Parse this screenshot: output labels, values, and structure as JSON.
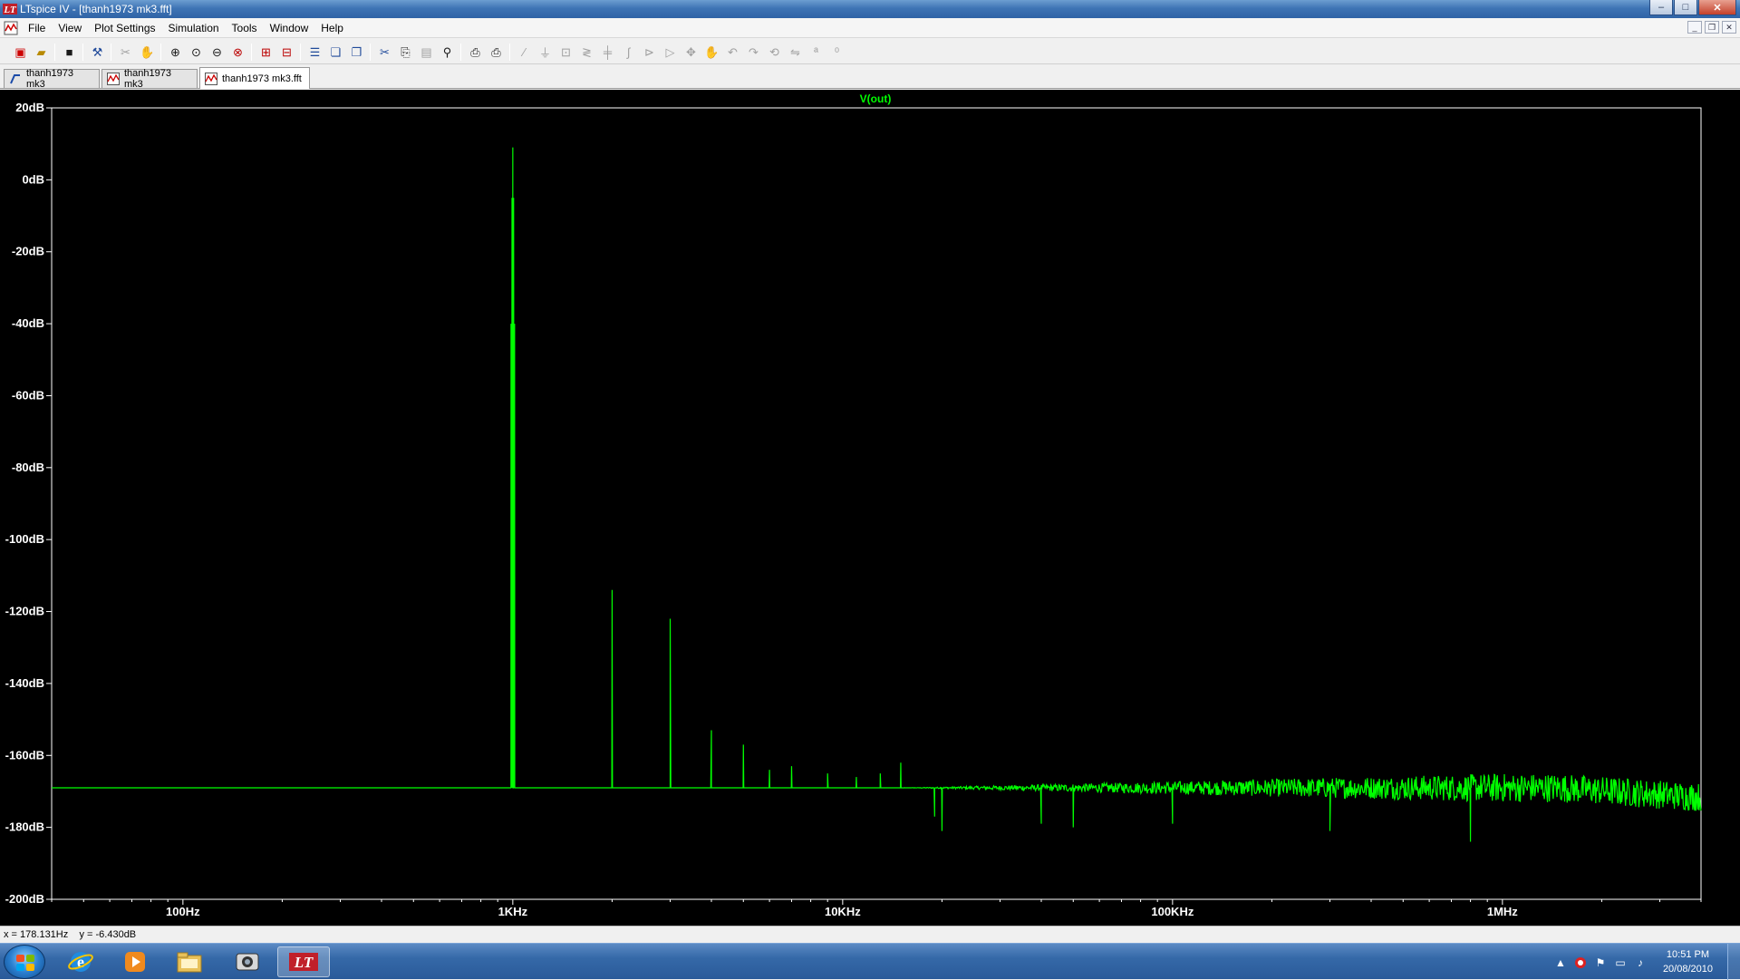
{
  "window": {
    "title": "LTspice IV - [thanh1973 mk3.fft]",
    "controls": {
      "minimize": "–",
      "maximize": "□",
      "close": "✕"
    }
  },
  "menu": {
    "items": [
      "File",
      "View",
      "Plot Settings",
      "Simulation",
      "Tools",
      "Window",
      "Help"
    ]
  },
  "mdi_controls": {
    "minimize": "_",
    "restore": "❐",
    "close": "✕"
  },
  "tabs": [
    {
      "label": "thanh1973 mk3",
      "icon": "schematic-icon"
    },
    {
      "label": "thanh1973 mk3",
      "icon": "waveform-icon"
    },
    {
      "label": "thanh1973 mk3.fft",
      "icon": "fft-icon",
      "active": true
    }
  ],
  "colors": {
    "trace": "#00ff00",
    "plot_bg": "#000000",
    "axis": "#ffffff",
    "trace_title": "#00ff00"
  },
  "chart_data": {
    "type": "line",
    "title": "V(out)",
    "xlabel": "",
    "ylabel": "",
    "x_scale": "log",
    "xlim": [
      40,
      4000000
    ],
    "ylim": [
      -200,
      20
    ],
    "x_ticks": [
      {
        "value": 100,
        "label": "100Hz"
      },
      {
        "value": 1000,
        "label": "1KHz"
      },
      {
        "value": 10000,
        "label": "10KHz"
      },
      {
        "value": 100000,
        "label": "100KHz"
      },
      {
        "value": 1000000,
        "label": "1MHz"
      }
    ],
    "y_ticks": [
      {
        "value": 20,
        "label": "20dB"
      },
      {
        "value": 0,
        "label": "0dB"
      },
      {
        "value": -20,
        "label": "-20dB"
      },
      {
        "value": -40,
        "label": "-40dB"
      },
      {
        "value": -60,
        "label": "-60dB"
      },
      {
        "value": -80,
        "label": "-80dB"
      },
      {
        "value": -100,
        "label": "-100dB"
      },
      {
        "value": -120,
        "label": "-120dB"
      },
      {
        "value": -140,
        "label": "-140dB"
      },
      {
        "value": -160,
        "label": "-160dB"
      },
      {
        "value": -180,
        "label": "-180dB"
      },
      {
        "value": -200,
        "label": "-200dB"
      }
    ],
    "grid": false,
    "noise_floor_db": -169,
    "series": [
      {
        "name": "V(out)",
        "peaks": [
          {
            "x": 1000,
            "y": 9
          },
          {
            "x": 2000,
            "y": -114
          },
          {
            "x": 3000,
            "y": -122
          },
          {
            "x": 4000,
            "y": -153
          },
          {
            "x": 5000,
            "y": -157
          },
          {
            "x": 6000,
            "y": -164
          },
          {
            "x": 7000,
            "y": -163
          },
          {
            "x": 9000,
            "y": -165
          },
          {
            "x": 11000,
            "y": -166
          },
          {
            "x": 13000,
            "y": -165
          },
          {
            "x": 15000,
            "y": -162
          },
          {
            "x": 19000,
            "y": -177
          },
          {
            "x": 20000,
            "y": -181
          },
          {
            "x": 40000,
            "y": -179
          },
          {
            "x": 50000,
            "y": -180
          },
          {
            "x": 100000,
            "y": -179
          },
          {
            "x": 300000,
            "y": -181
          },
          {
            "x": 800000,
            "y": -184
          }
        ]
      }
    ]
  },
  "status": {
    "cursor": "x = 178.131Hz    y = -6.430dB"
  },
  "taskbar": {
    "clock_time": "10:51 PM",
    "clock_date": "20/08/2010",
    "apps": [
      "internet-explorer-icon",
      "media-player-icon",
      "file-explorer-icon",
      "camera-app-icon",
      "ltspice-icon"
    ]
  }
}
